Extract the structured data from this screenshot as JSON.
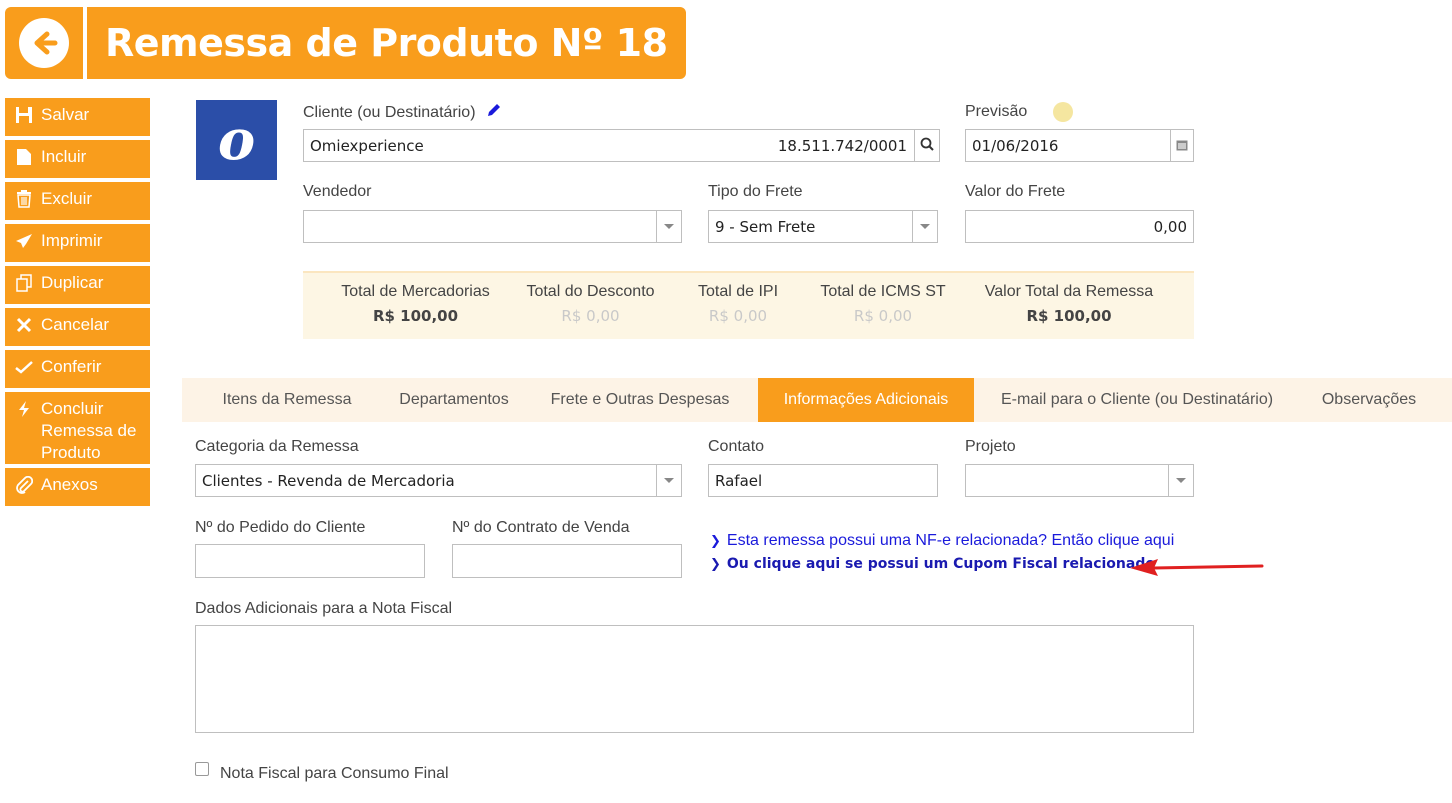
{
  "header": {
    "title": "Remessa de Produto Nº 18"
  },
  "sidebar": {
    "items": [
      {
        "label": "Salvar",
        "icon": "save-icon"
      },
      {
        "label": "Incluir",
        "icon": "file-icon"
      },
      {
        "label": "Excluir",
        "icon": "trash-icon"
      },
      {
        "label": "Imprimir",
        "icon": "send-icon"
      },
      {
        "label": "Duplicar",
        "icon": "copy-icon"
      },
      {
        "label": "Cancelar",
        "icon": "close-icon"
      },
      {
        "label": "Conferir",
        "icon": "check-icon"
      },
      {
        "label": "Concluir\nRemessa de\nProduto",
        "icon": "bolt-icon"
      },
      {
        "label": "Anexos",
        "icon": "paperclip-icon"
      }
    ]
  },
  "form": {
    "cliente_label": "Cliente (ou Destinatário)",
    "cliente_name": "Omiexperience",
    "cliente_doc": "18.511.742/0001",
    "previsao_label": "Previsão",
    "previsao_value": "01/06/2016",
    "vendedor_label": "Vendedor",
    "vendedor_value": "",
    "tipo_frete_label": "Tipo do Frete",
    "tipo_frete_value": "9 - Sem Frete",
    "valor_frete_label": "Valor do Frete",
    "valor_frete_value": "0,00"
  },
  "totals": [
    {
      "label": "Total de Mercadorias",
      "value": "R$ 100,00"
    },
    {
      "label": "Total do Desconto",
      "value": "R$ 0,00"
    },
    {
      "label": "Total de IPI",
      "value": "R$ 0,00"
    },
    {
      "label": "Total de ICMS ST",
      "value": "R$ 0,00"
    },
    {
      "label": "Valor Total da Remessa",
      "value": "R$ 100,00"
    }
  ],
  "tabs": [
    {
      "label": "Itens da Remessa"
    },
    {
      "label": "Departamentos"
    },
    {
      "label": "Frete e Outras Despesas"
    },
    {
      "label": "Informações Adicionais"
    },
    {
      "label": "E-mail para o Cliente (ou Destinatário)"
    },
    {
      "label": "Observações"
    }
  ],
  "info": {
    "categoria_label": "Categoria da Remessa",
    "categoria_value": "Clientes - Revenda de Mercadoria",
    "contato_label": "Contato",
    "contato_value": "Rafael",
    "projeto_label": "Projeto",
    "projeto_value": "",
    "pedido_label": "Nº do Pedido do Cliente",
    "pedido_value": "",
    "contrato_label": "Nº do Contrato de Venda",
    "contrato_value": "",
    "link_nfe": "Esta remessa possui uma NF-e relacionada? Então clique aqui",
    "link_cupom": "Ou clique aqui se possui um Cupom Fiscal relacionado",
    "dados_label": "Dados Adicionais para a Nota Fiscal",
    "dados_value": "",
    "consumo_label": "Nota Fiscal para Consumo Final"
  },
  "colors": {
    "accent": "#f99d1c",
    "logo_bg": "#2b4ea8",
    "link": "#1a1adb",
    "arrow": "#e02020"
  }
}
